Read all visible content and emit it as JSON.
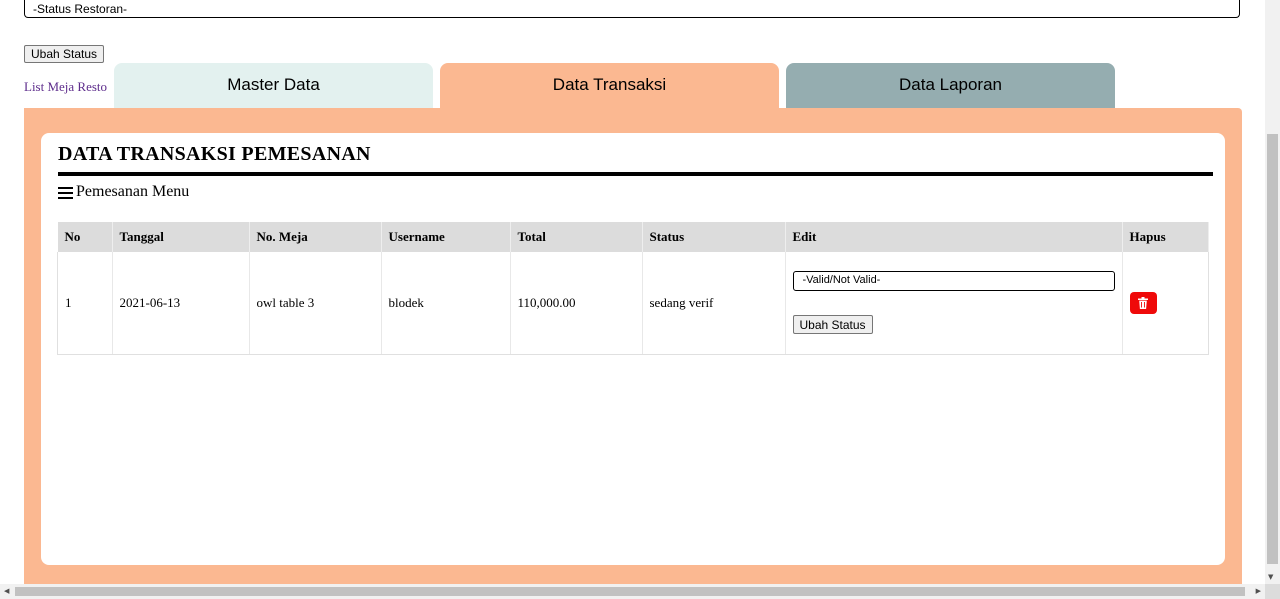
{
  "top": {
    "status_select": "-Status Restoran-",
    "ubah_status": "Ubah Status",
    "list_link": "List Meja Resto"
  },
  "tabs": [
    {
      "label": "Master Data"
    },
    {
      "label": "Data Transaksi"
    },
    {
      "label": "Data Laporan"
    }
  ],
  "card": {
    "title": "DATA TRANSAKSI PEMESANAN",
    "subtitle": "Pemesanan Menu",
    "subtitle_icon": "menu-icon"
  },
  "table": {
    "headers": [
      "No",
      "Tanggal",
      "No. Meja",
      "Username",
      "Total",
      "Status",
      "Edit",
      "Hapus"
    ],
    "rows": [
      {
        "no": "1",
        "tanggal": "2021-06-13",
        "meja": "owl table 3",
        "username": "blodek",
        "total": "110,000.00",
        "status": "sedang verif",
        "edit_select": "-Valid/Not Valid-",
        "edit_button": "Ubah Status",
        "hapus_icon": "trash-icon"
      }
    ]
  },
  "colors": {
    "tab_master": "#e3f1ef",
    "tab_transaksi": "#fbb891",
    "tab_laporan": "#95adb0",
    "delete": "#ef0a0a",
    "link": "#5e2d8c"
  }
}
